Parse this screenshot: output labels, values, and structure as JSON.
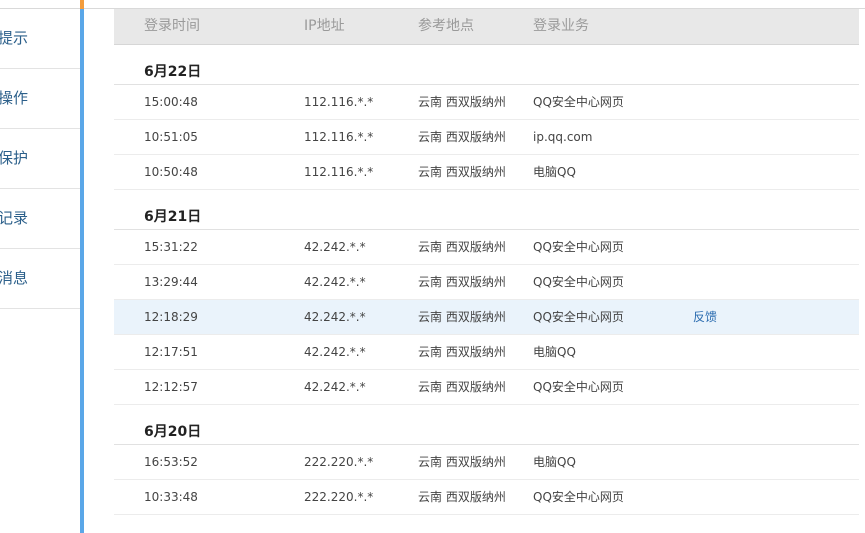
{
  "sidebar": {
    "items": [
      {
        "label": "提示"
      },
      {
        "label": "操作"
      },
      {
        "label": "保护"
      },
      {
        "label": "记录"
      },
      {
        "label": "消息"
      }
    ]
  },
  "table": {
    "headers": {
      "time": "登录时间",
      "ip": "IP地址",
      "location": "参考地点",
      "service": "登录业务"
    },
    "groups": [
      {
        "date": "6月22日",
        "rows": [
          {
            "time": "15:00:48",
            "ip": "112.116.*.*",
            "location": "云南 西双版纳州",
            "service": "QQ安全中心网页",
            "action": ""
          },
          {
            "time": "10:51:05",
            "ip": "112.116.*.*",
            "location": "云南 西双版纳州",
            "service": "ip.qq.com",
            "action": ""
          },
          {
            "time": "10:50:48",
            "ip": "112.116.*.*",
            "location": "云南 西双版纳州",
            "service": "电脑QQ",
            "action": ""
          }
        ]
      },
      {
        "date": "6月21日",
        "rows": [
          {
            "time": "15:31:22",
            "ip": "42.242.*.*",
            "location": "云南 西双版纳州",
            "service": "QQ安全中心网页",
            "action": ""
          },
          {
            "time": "13:29:44",
            "ip": "42.242.*.*",
            "location": "云南 西双版纳州",
            "service": "QQ安全中心网页",
            "action": ""
          },
          {
            "time": "12:18:29",
            "ip": "42.242.*.*",
            "location": "云南 西双版纳州",
            "service": "QQ安全中心网页",
            "action": "反馈",
            "highlighted": true
          },
          {
            "time": "12:17:51",
            "ip": "42.242.*.*",
            "location": "云南 西双版纳州",
            "service": "电脑QQ",
            "action": ""
          },
          {
            "time": "12:12:57",
            "ip": "42.242.*.*",
            "location": "云南 西双版纳州",
            "service": "QQ安全中心网页",
            "action": ""
          }
        ]
      },
      {
        "date": "6月20日",
        "rows": [
          {
            "time": "16:53:52",
            "ip": "222.220.*.*",
            "location": "云南 西双版纳州",
            "service": "电脑QQ",
            "action": ""
          },
          {
            "time": "10:33:48",
            "ip": "222.220.*.*",
            "location": "云南 西双版纳州",
            "service": "QQ安全中心网页",
            "action": ""
          }
        ]
      }
    ]
  },
  "colors": {
    "sidebar_accent": "#5aa7e8",
    "top_accent": "#f39c3c",
    "link": "#2b6cb0",
    "highlight_row": "#eaf3fb"
  }
}
